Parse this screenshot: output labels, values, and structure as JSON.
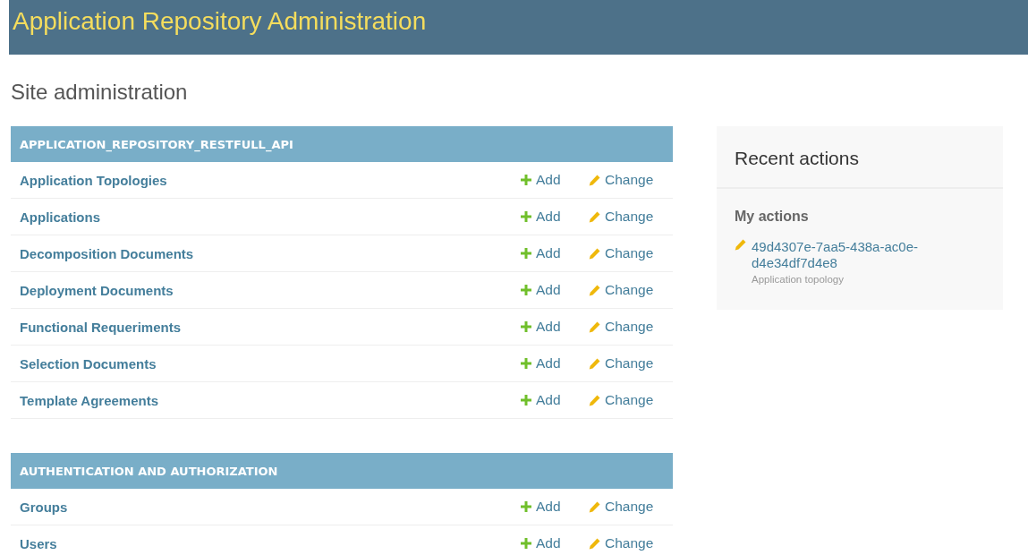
{
  "header": {
    "title": "Application Repository Administration"
  },
  "page_title": "Site administration",
  "modules": [
    {
      "caption": "APPLICATION_REPOSITORY_RESTFULL_API",
      "rows": [
        {
          "name": "Application Topologies",
          "add": "Add",
          "change": "Change"
        },
        {
          "name": "Applications",
          "add": "Add",
          "change": "Change"
        },
        {
          "name": "Decomposition Documents",
          "add": "Add",
          "change": "Change"
        },
        {
          "name": "Deployment Documents",
          "add": "Add",
          "change": "Change"
        },
        {
          "name": "Functional Requeriments",
          "add": "Add",
          "change": "Change"
        },
        {
          "name": "Selection Documents",
          "add": "Add",
          "change": "Change"
        },
        {
          "name": "Template Agreements",
          "add": "Add",
          "change": "Change"
        }
      ]
    },
    {
      "caption": "AUTHENTICATION AND AUTHORIZATION",
      "rows": [
        {
          "name": "Groups",
          "add": "Add",
          "change": "Change"
        },
        {
          "name": "Users",
          "add": "Add",
          "change": "Change"
        }
      ]
    }
  ],
  "recent_actions": {
    "title": "Recent actions",
    "subtitle": "My actions",
    "items": [
      {
        "kind": "change",
        "label": "49d4307e-7aa5-438a-ac0e-d4e34df7d4e8",
        "type": "Application topology"
      }
    ]
  }
}
